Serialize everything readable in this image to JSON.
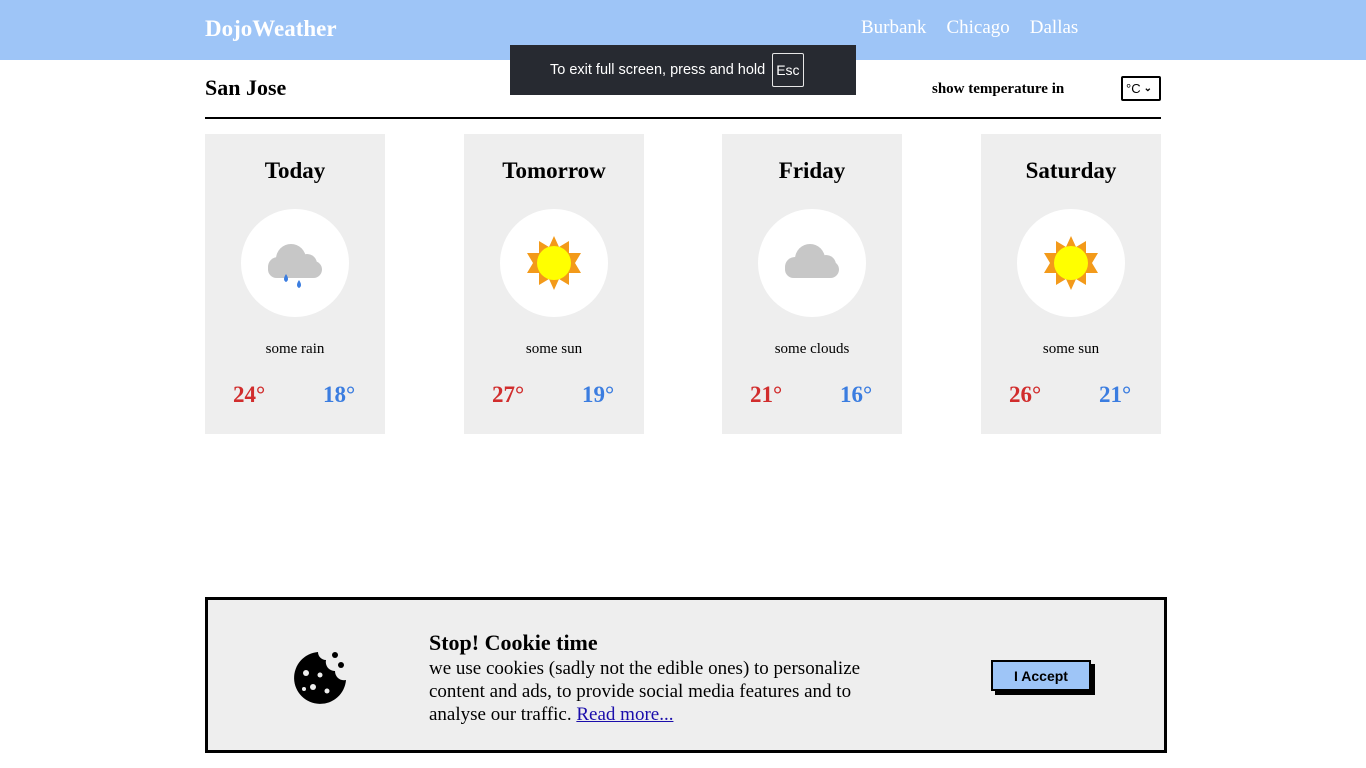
{
  "header": {
    "brand": "DojoWeather",
    "nav": [
      "Burbank",
      "Chicago",
      "Dallas"
    ],
    "bg_color": "#9ec5f7"
  },
  "fullscreen_notice": {
    "text": "To exit full screen, press and hold",
    "key": "Esc"
  },
  "location": {
    "city": "San Jose",
    "unit_label": "show temperature in",
    "unit_selected": "°C"
  },
  "forecast": [
    {
      "day": "Today",
      "icon": "rain-cloud-icon",
      "desc": "some rain",
      "high": "24°",
      "low": "18°"
    },
    {
      "day": "Tomorrow",
      "icon": "sun-icon",
      "desc": "some sun",
      "high": "27°",
      "low": "19°"
    },
    {
      "day": "Friday",
      "icon": "cloud-icon",
      "desc": "some clouds",
      "high": "21°",
      "low": "16°"
    },
    {
      "day": "Saturday",
      "icon": "sun-icon",
      "desc": "some sun",
      "high": "26°",
      "low": "21°"
    }
  ],
  "colors": {
    "high_temp": "#d12d2d",
    "low_temp": "#3b7de0",
    "card_bg": "#eeeeee"
  },
  "cookie": {
    "title": "Stop! Cookie time",
    "text": "we use cookies (sadly not the edible ones) to personalize content and ads, to provide social media features and to analyse our traffic.",
    "link": "Read more...",
    "button": "I Accept",
    "icon": "cookie-icon"
  }
}
